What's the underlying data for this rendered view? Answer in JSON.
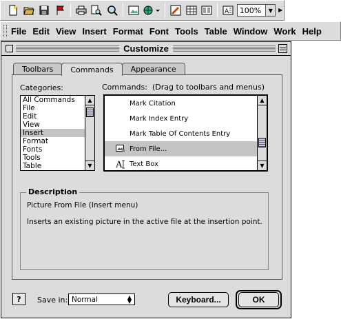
{
  "toolbar": {
    "icons": [
      "new-icon",
      "open-icon",
      "save-icon",
      "flag-icon",
      "print-icon",
      "print-preview-icon",
      "find-icon",
      "insert-picture-icon",
      "web-icon",
      "format-painter-icon",
      "table-icon",
      "columns-icon",
      "text-box-icon"
    ],
    "zoom_value": "100%"
  },
  "menubar": {
    "items": [
      "File",
      "Edit",
      "View",
      "Insert",
      "Format",
      "Font",
      "Tools",
      "Table",
      "Window",
      "Work",
      "Help"
    ]
  },
  "dialog": {
    "title": "Customize",
    "tabs": [
      "Toolbars",
      "Commands",
      "Appearance"
    ],
    "active_tab": "Commands",
    "categories_label": "Categories:",
    "categories": [
      "All Commands",
      "File",
      "Edit",
      "View",
      "Insert",
      "Format",
      "Fonts",
      "Tools",
      "Table"
    ],
    "selected_category": "Insert",
    "commands_label": "Commands:",
    "commands_hint": "(Drag to toolbars and menus)",
    "commands": [
      {
        "label": "Mark Citation",
        "icon": ""
      },
      {
        "label": "Mark Index Entry",
        "icon": ""
      },
      {
        "label": "Mark Table Of Contents Entry",
        "icon": ""
      },
      {
        "label": "From File...",
        "icon": "picture-icon"
      },
      {
        "label": "Text Box",
        "icon": "text-box-icon"
      }
    ],
    "selected_command": "From File...",
    "description_legend": "Description",
    "description_title": "Picture From File (Insert menu)",
    "description_body": "Inserts an existing picture in the active file at the insertion point.",
    "save_in_label": "Save in:",
    "save_in_value": "Normal",
    "keyboard_button": "Keyboard...",
    "ok_button": "OK",
    "help_icon_glyph": "?"
  }
}
